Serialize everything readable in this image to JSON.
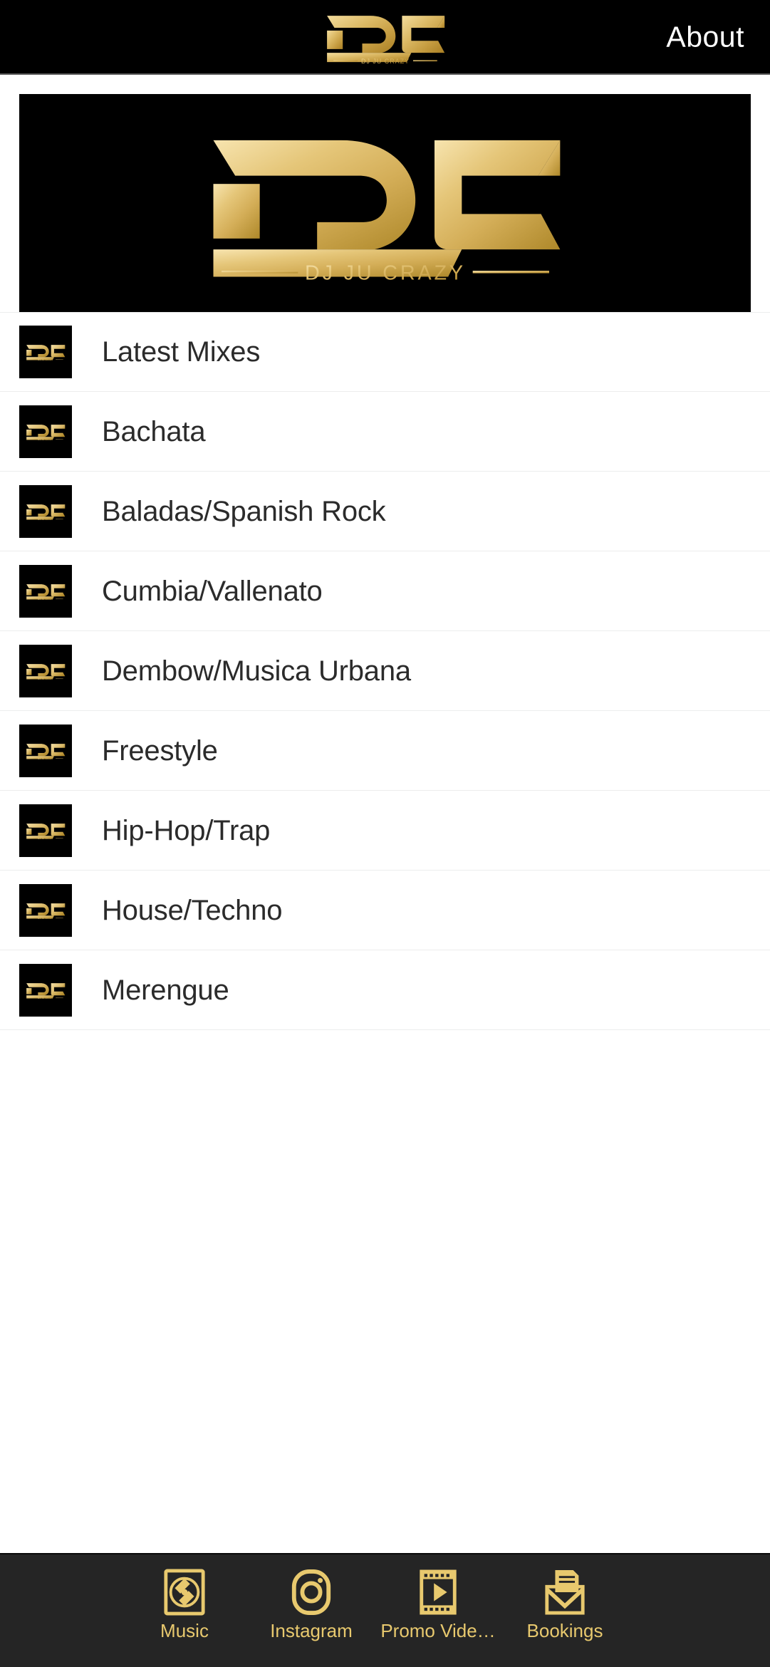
{
  "header": {
    "logo_alt": "DJ JU CRAZY",
    "about_label": "About"
  },
  "banner": {
    "logo_mark": "DJC",
    "logo_tagline": "DJ JU CRAZY"
  },
  "list": {
    "items": [
      {
        "label": "Latest Mixes",
        "icon": "dj-logo-thumb"
      },
      {
        "label": "Bachata",
        "icon": "dj-logo-thumb"
      },
      {
        "label": "Baladas/Spanish Rock",
        "icon": "dj-logo-thumb"
      },
      {
        "label": "Cumbia/Vallenato",
        "icon": "dj-logo-thumb"
      },
      {
        "label": "Dembow/Musica Urbana",
        "icon": "dj-logo-thumb"
      },
      {
        "label": "Freestyle",
        "icon": "dj-logo-thumb"
      },
      {
        "label": "Hip-Hop/Trap",
        "icon": "dj-logo-thumb"
      },
      {
        "label": "House/Techno",
        "icon": "dj-logo-thumb"
      },
      {
        "label": "Merengue",
        "icon": "dj-logo-thumb"
      }
    ]
  },
  "tabbar": {
    "tabs": [
      {
        "label": "Music",
        "icon": "vinyl-record-icon"
      },
      {
        "label": "Instagram",
        "icon": "instagram-icon"
      },
      {
        "label": "Promo Vide…",
        "icon": "film-play-icon"
      },
      {
        "label": "Bookings",
        "icon": "envelope-letter-icon"
      }
    ]
  },
  "colors": {
    "gold_light": "#f0d58c",
    "gold_mid": "#dbb863",
    "gold_dark": "#b9912f",
    "header_bg": "#000000",
    "tabbar_bg": "#252525",
    "tab_label": "#e8c96e",
    "list_text": "#2b2b2b",
    "divider": "#eceded",
    "page_bg": "#ffffff"
  }
}
